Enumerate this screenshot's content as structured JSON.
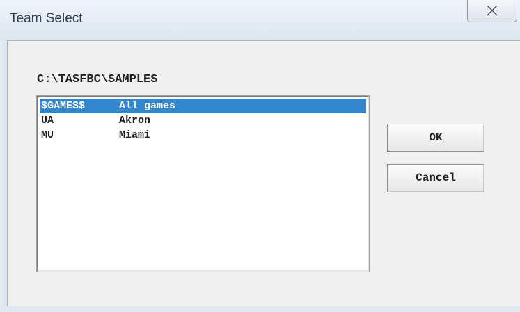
{
  "window": {
    "title": "Team Select",
    "close_icon": "close-icon"
  },
  "path": "C:\\TASFBC\\SAMPLES",
  "teams": [
    {
      "code": "$GAMES$",
      "name": "All games",
      "selected": true
    },
    {
      "code": "UA",
      "name": "Akron",
      "selected": false
    },
    {
      "code": "MU",
      "name": "Miami",
      "selected": false
    }
  ],
  "buttons": {
    "ok_label": "OK",
    "cancel_label": "Cancel"
  },
  "colors": {
    "selection": "#3286cf",
    "title_text": "#2f3e55"
  }
}
